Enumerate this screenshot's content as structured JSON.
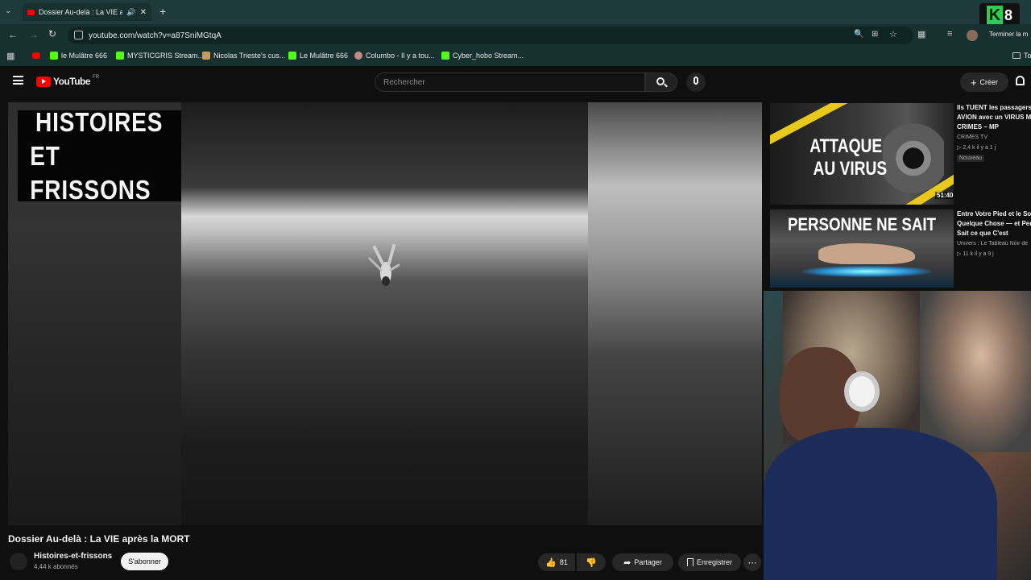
{
  "browser": {
    "tab_title": "Dossier Au-delà : La VIE ap",
    "new_tab": "+",
    "url": "youtube.com/watch?v=a87SniMGtqA",
    "terminate_label": "Terminer la m",
    "bookmarks": [
      {
        "label": "le Mulâtre 666",
        "color": "#53fc18"
      },
      {
        "label": "MYSTICGRIS Stream...",
        "color": "#53fc18"
      },
      {
        "label": "Nicolas Trieste's cus...",
        "color": "#c99a5b"
      },
      {
        "label": "Le Mulâtre 666",
        "color": "#53fc18"
      },
      {
        "label": "Columbo - Il y a tou...",
        "color": "#c48a8a"
      },
      {
        "label": "Cyber_hobo Stream...",
        "color": "#53fc18"
      }
    ],
    "bookmarks_folder": "To"
  },
  "youtube": {
    "logo_text": "YouTube",
    "country": "FR",
    "search_placeholder": "Rechercher",
    "create_label": "Créer"
  },
  "video": {
    "title": "Dossier Au-delà : La VIE après la MORT",
    "channel_logo_line1": "HISTOIRES",
    "channel_logo_line2": "ET FRISSONS",
    "channel_name": "Histoires-et-frissons",
    "subscribers": "4,44 k abonnés",
    "subscribe_label": "S'abonner",
    "likes": "81",
    "share_label": "Partager",
    "save_label": "Enregistrer"
  },
  "recommendations": [
    {
      "thumb_text_line1": "ATTAQUE",
      "thumb_text_line2": "AU VIRUS",
      "duration": "51:40",
      "title_line1": "Ils TUENT les passagers",
      "title_line2": "AVION avec un VIRUS M",
      "title_line3": "CRIMES – MP",
      "channel": "CRIMES TV",
      "meta": "▷ 2,4 k  il y a 1 j",
      "badge": "Nouveau"
    },
    {
      "thumb_text_line1": "PERSONNE NE SAIT",
      "title_line1": "Entre Votre Pied et le So",
      "title_line2": "Quelque Chose — et Per",
      "title_line3": "Sait ce que C'est",
      "channel": "Univers : Le Tableau Noir de",
      "meta": "▷ 11 k  il y a 9 j"
    }
  ],
  "overlay": {
    "brand": "K",
    "number": "8"
  }
}
